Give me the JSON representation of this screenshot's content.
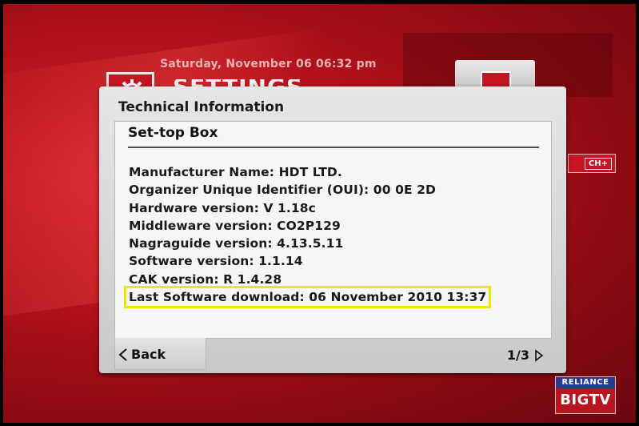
{
  "header": {
    "datetime": "Saturday, November 06  06:32 pm",
    "settings_title": "SETTINGS"
  },
  "ch_buttons": {
    "ch_plus": "CH+"
  },
  "dialog": {
    "title": "Technical Information",
    "section_title": "Set-top Box",
    "lines": [
      "Manufacturer Name: HDT LTD.",
      "Organizer Unique Identifier (OUI): 00 0E 2D",
      "Hardware version: V 1.18c",
      "Middleware version: CO2P129",
      "Nagraguide version: 4.13.5.11",
      "Software version: 1.1.14",
      "CAK version: R 1.4.28",
      "Last Software download: 06 November 2010 13:37"
    ],
    "back_label": "Back",
    "page_indicator": "1/3"
  },
  "logo": {
    "top": "RELIANCE",
    "bottom": "BIGTV"
  },
  "colors": {
    "background_red": "#b5121b",
    "highlight_yellow": "#f2e600",
    "dialog_grey": "#d6d6d6"
  },
  "icons": [
    "gear-icon",
    "back-arrow-icon",
    "next-arrow-icon"
  ]
}
